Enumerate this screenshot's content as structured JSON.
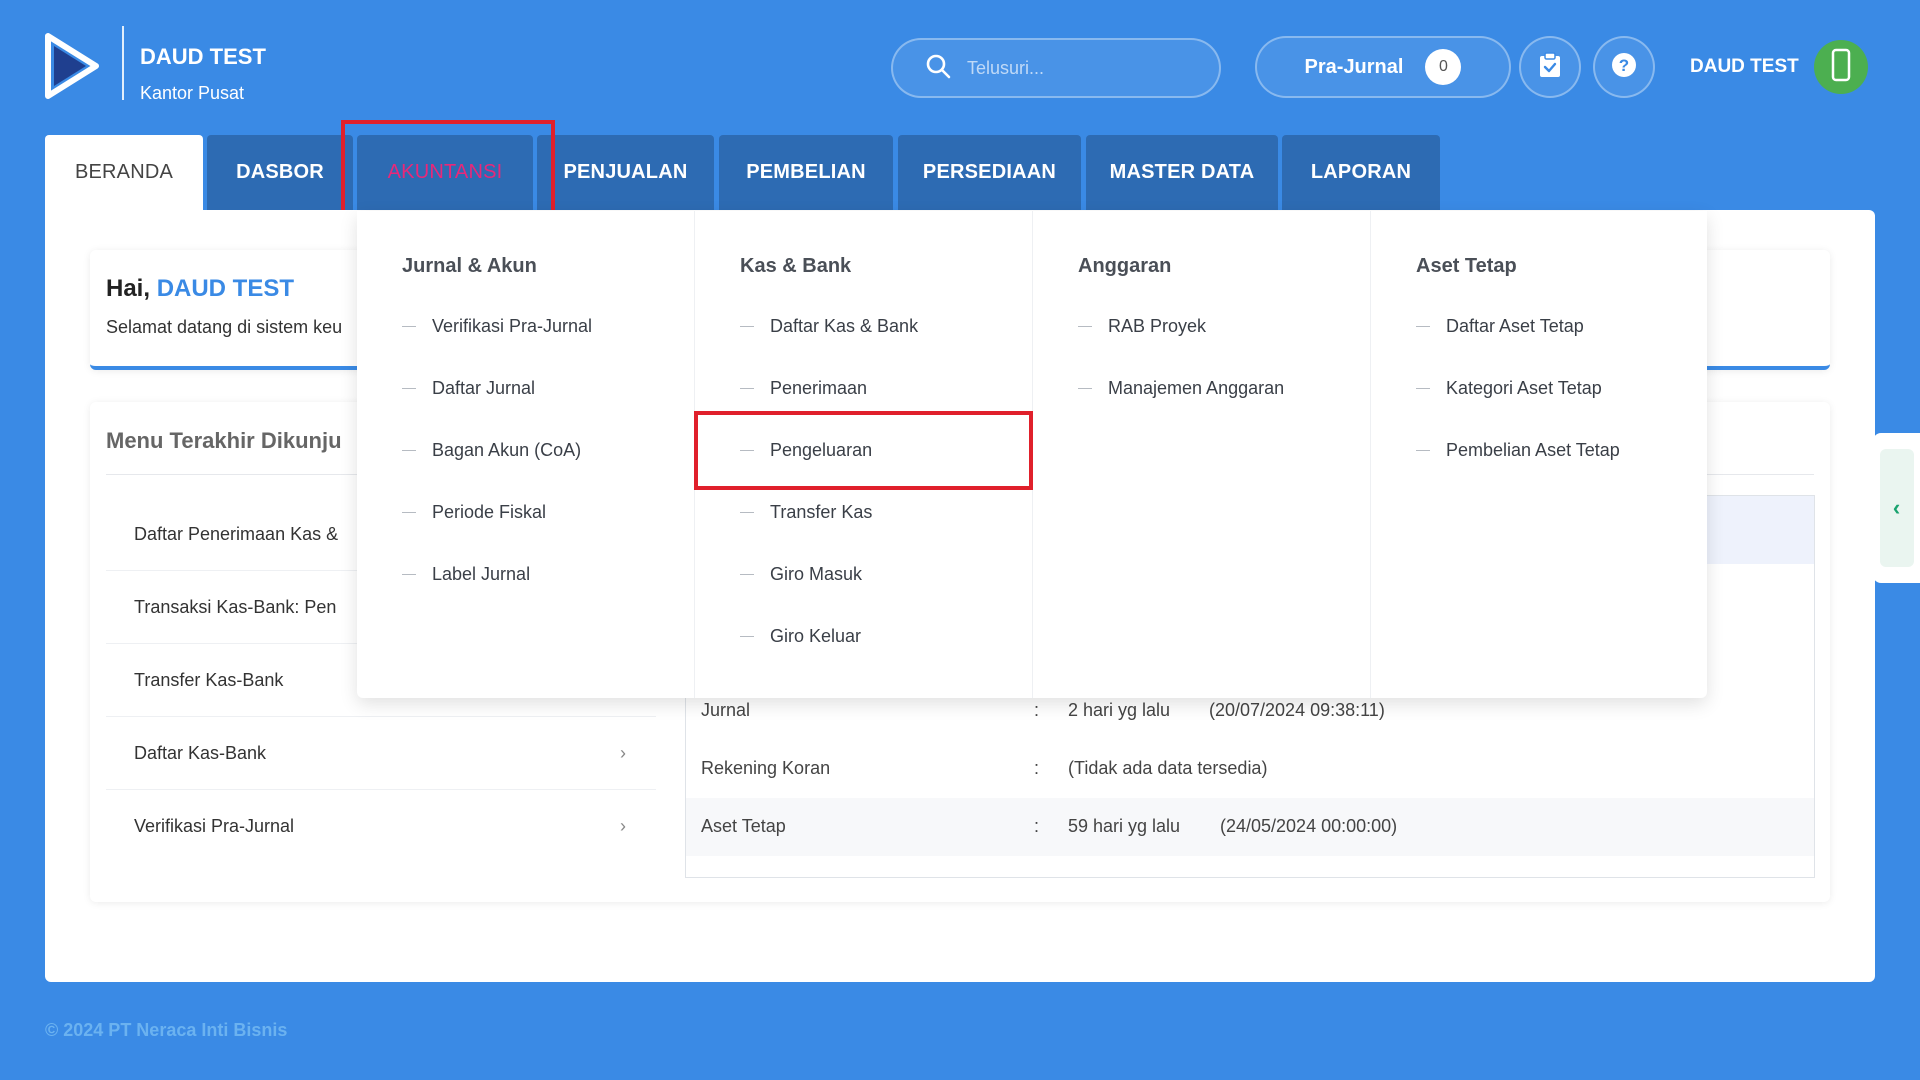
{
  "header": {
    "company_name": "DAUD TEST",
    "branch": "Kantor Pusat",
    "search_placeholder": "Telusuri...",
    "prajurnal_label": "Pra-Jurnal",
    "prajurnal_count": "0",
    "user_name": "DAUD TEST"
  },
  "nav": {
    "tabs": [
      {
        "label": "BERANDA"
      },
      {
        "label": "DASBOR"
      },
      {
        "label": "AKUNTANSI"
      },
      {
        "label": "PENJUALAN"
      },
      {
        "label": "PEMBELIAN"
      },
      {
        "label": "PERSEDIAAN"
      },
      {
        "label": "MASTER DATA"
      },
      {
        "label": "LAPORAN"
      }
    ]
  },
  "welcome": {
    "greeting": "Hai,",
    "user": "DAUD TEST",
    "subtitle": "Selamat datang di sistem keu"
  },
  "recent": {
    "title": "Menu Terakhir Dikunju",
    "items": [
      {
        "label": "Daftar Penerimaan Kas &"
      },
      {
        "label": "Transaksi Kas-Bank: Pen"
      },
      {
        "label": "Transfer Kas-Bank"
      },
      {
        "label": "Daftar Kas-Bank"
      },
      {
        "label": "Verifikasi Pra-Jurnal"
      }
    ]
  },
  "status": {
    "rows": [
      {
        "label": "Jurnal",
        "sep": ":",
        "ago": "2 hari yg lalu",
        "datetime": "(20/07/2024 09:38:11)"
      },
      {
        "label": "Rekening Koran",
        "sep": ":",
        "ago": "(Tidak ada data tersedia)",
        "datetime": ""
      },
      {
        "label": "Aset Tetap",
        "sep": ":",
        "ago": "59 hari yg lalu",
        "datetime": "(24/05/2024 00:00:00)"
      }
    ]
  },
  "mega_menu": {
    "columns": [
      {
        "title": "Jurnal & Akun",
        "items": [
          "Verifikasi Pra-Jurnal",
          "Daftar Jurnal",
          "Bagan Akun (CoA)",
          "Periode Fiskal",
          "Label Jurnal"
        ]
      },
      {
        "title": "Kas & Bank",
        "items": [
          "Daftar Kas & Bank",
          "Penerimaan",
          "Pengeluaran",
          "Transfer Kas",
          "Giro Masuk",
          "Giro Keluar"
        ]
      },
      {
        "title": "Anggaran",
        "items": [
          "RAB Proyek",
          "Manajemen Anggaran"
        ]
      },
      {
        "title": "Aset Tetap",
        "items": [
          "Daftar Aset Tetap",
          "Kategori Aset Tetap",
          "Pembelian Aset Tetap"
        ]
      }
    ]
  },
  "footer": {
    "copyright": "© 2024 PT Neraca Inti Bisnis"
  },
  "colors": {
    "background": "#3a8ae5",
    "tab": "#2d6bb3",
    "accent_pink": "#e8287a",
    "highlight_red": "#e0202b"
  }
}
